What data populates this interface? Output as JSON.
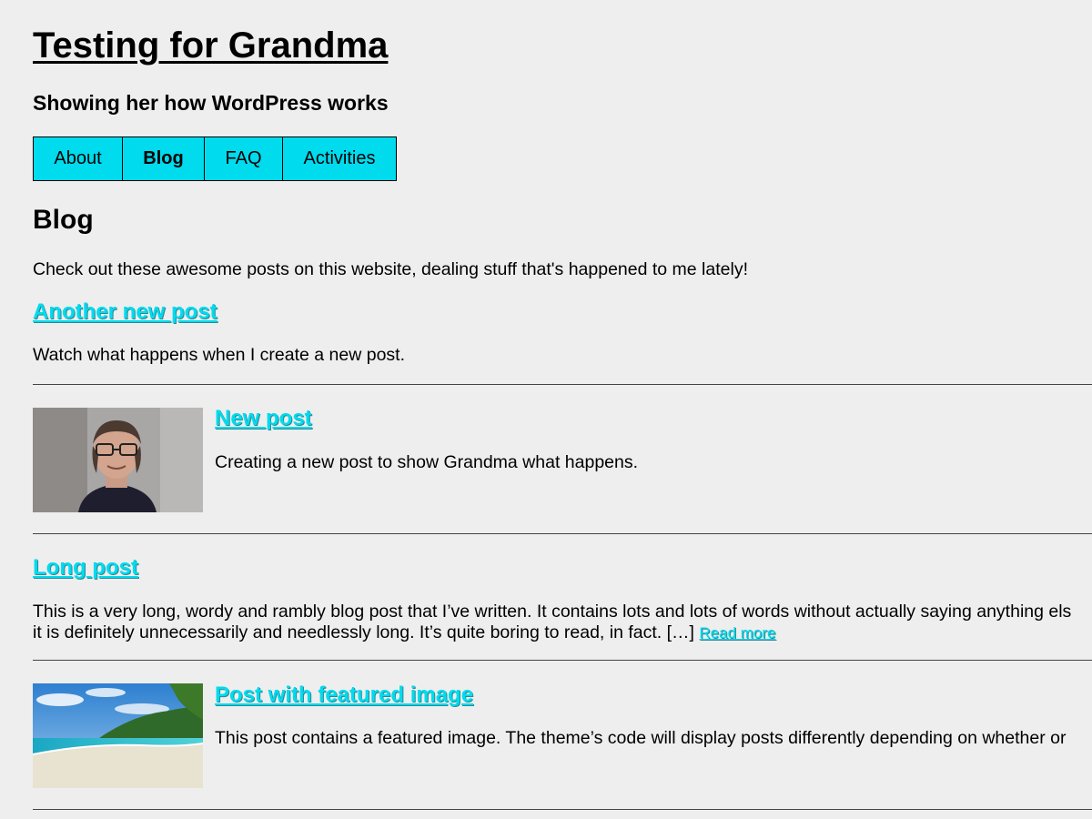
{
  "site": {
    "title": "Testing for Grandma",
    "tagline": "Showing her how WordPress works"
  },
  "nav": {
    "items": [
      {
        "label": "About"
      },
      {
        "label": "Blog"
      },
      {
        "label": "FAQ"
      },
      {
        "label": "Activities"
      }
    ],
    "active": "Blog"
  },
  "page": {
    "heading": "Blog",
    "intro": "Check out these awesome posts on this website, dealing stuff that's happened to me lately!"
  },
  "posts": [
    {
      "title": "Another new post",
      "excerpt": "Watch what happens when I create a new post."
    },
    {
      "title": "New post",
      "excerpt": "Creating a new post to show Grandma what happens.",
      "thumbnail": "portrait-photo"
    },
    {
      "title": "Long post",
      "excerpt_line1": "This is a very long, wordy and rambly blog post that I’ve written. It contains lots and lots of words without actually saying anything els",
      "excerpt_line2": "it is definitely unnecessarily and needlessly long. It’s quite boring to read, in fact. […]",
      "read_more": "Read more"
    },
    {
      "title": "Post with featured image",
      "excerpt": "This post contains a featured image. The theme’s code will display posts differently depending on whether or",
      "thumbnail": "beach-photo"
    }
  ],
  "colors": {
    "background": "#eeeeee",
    "accent": "#00dbee",
    "text": "#000000"
  }
}
